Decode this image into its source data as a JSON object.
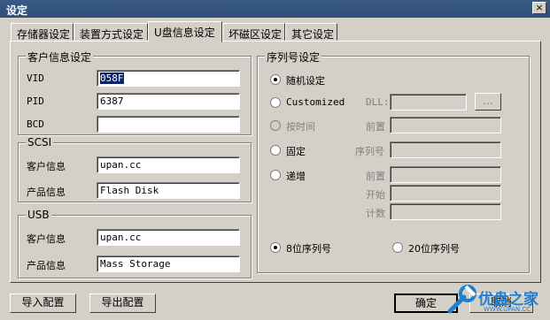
{
  "window": {
    "title": "设定",
    "close": "×"
  },
  "tabs": [
    "存储器设定",
    "装置方式设定",
    "U盘信息设定",
    "坏磁区设定",
    "其它设定"
  ],
  "customer": {
    "legend": "客户信息设定",
    "vid_label": "VID",
    "vid_value": "058F",
    "pid_label": "PID",
    "pid_value": "6387",
    "bcd_label": "BCD",
    "bcd_value": ""
  },
  "scsi": {
    "legend": "SCSI",
    "vendor_label": "客户信息",
    "vendor_value": "upan.cc",
    "product_label": "产品信息",
    "product_value": "Flash Disk"
  },
  "usb": {
    "legend": "USB",
    "vendor_label": "客户信息",
    "vendor_value": "upan.cc",
    "product_label": "产品信息",
    "product_value": "Mass Storage"
  },
  "serial": {
    "legend": "序列号设定",
    "random": "随机设定",
    "customized": "Customized",
    "dll_label": "DLL:",
    "browse": "...",
    "by_time": "按时间",
    "prefix_label": "前置",
    "fixed": "固定",
    "serial_label": "序列号",
    "increment": "递增",
    "inc_prefix_label": "前置",
    "start_label": "开始",
    "count_label": "计数",
    "len8": "8位序列号",
    "len20": "20位序列号"
  },
  "footer": {
    "import": "导入配置",
    "export": "导出配置",
    "ok": "确定",
    "cancel": "取消"
  },
  "logo": {
    "text": "优盘之家",
    "sub": "WWW.UPAN.CC"
  },
  "colors": {
    "title_bar": "#2f4f7a",
    "dialog": "#d4d0c8",
    "selection": "#0a246a",
    "logo_blue": "#1f7fd0"
  }
}
